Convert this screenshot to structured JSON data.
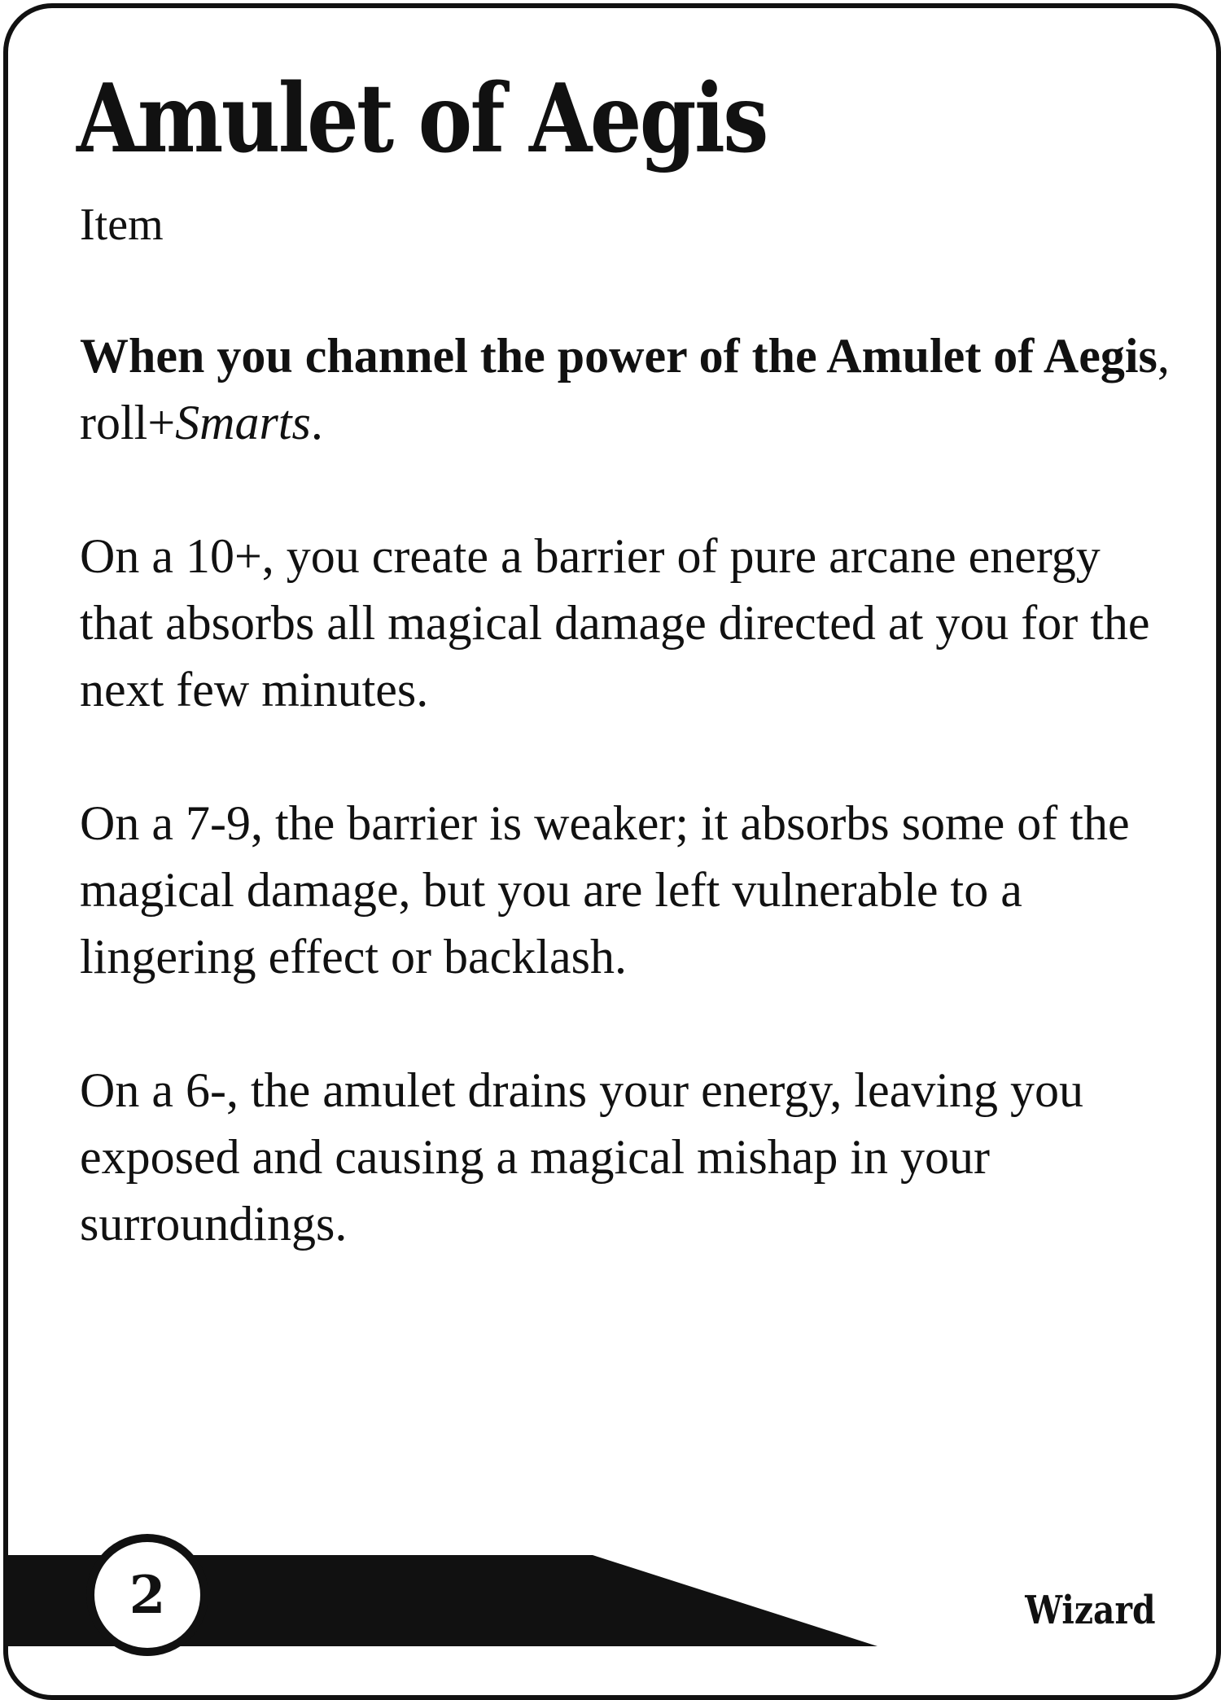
{
  "card": {
    "title": "Amulet of Aegis",
    "type": "Item",
    "trigger": {
      "bold_part": "When you channel the power of the Amulet of Aegis",
      "separator": ", roll+",
      "stat": "Smarts",
      "end": "."
    },
    "outcomes": [
      "On a 10+, you create a barrier of pure arcane energy that absorbs all magical damage directed at you for the next few minutes.",
      "On a 7-9, the barrier is weaker; it absorbs some of the magical damage, but you are left vulnerable to a lingering effect or backlash.",
      "On a 6-, the amulet drains your energy, leaving you exposed and causing a magical mishap in your surroundings."
    ],
    "cost": "2",
    "class": "Wizard"
  },
  "colors": {
    "ink": "#111111",
    "paper": "#ffffff"
  }
}
